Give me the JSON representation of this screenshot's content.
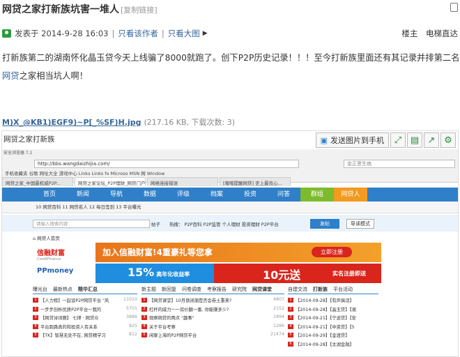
{
  "post": {
    "title": "网贷之家打新族坑害一堆人",
    "copy_link": "[复制链接]",
    "meta": {
      "posted": "发表于 2014-9-28 16:03",
      "sep": "|",
      "only_author": "只看该作者",
      "only_big_image": "只看大图",
      "floor_label": "楼主",
      "elevator": "电梯直达"
    },
    "body_line1": "打新族第二的湖南怀化晶玉贷今天上线骗了8000就跑了。创下P2P历史记录！！！至今打新族里面还有其记录并排第二名",
    "body_line2_link": "网贷",
    "body_line2_rest": "之家相当坑人啊！",
    "attachment": {
      "filename": "M)X_@KB1)EGF9)~P[_%SF)H.jpg",
      "info": "(217.16 KB, 下载次数: 3)"
    }
  },
  "image": {
    "watermark_title": "网贷之家打新族",
    "send_to_phone": "发送图片到手机",
    "window_label": "安全浏览器 7.1",
    "address": "http://bbs.wangdaizhijia.com/",
    "search_hint": "金正恩生病",
    "favorites": "手机收藏夹  谷歌  网址大全  游戏中心  Links  Links fo  Microso  MSN 网  Window",
    "tabs": [
      "网贷之家_中国最权威P2P...",
      "网贷之家论坛_P2P理财_网贷门户",
      "网络连接错误",
      "[喀喀提醒网贷] 史上最良心..."
    ],
    "nav": [
      "首页",
      "新闻",
      "导航",
      "数据",
      "评级",
      "档案",
      "投资",
      "问答",
      "群组",
      "网贷人"
    ],
    "subnav": "10 网贷百科    11 网贷名人    12 每日签到    13 平台曝光",
    "search_placeholder": "请输入搜索内容",
    "search_select": "帖子",
    "hot": "热搜：  P2P百科  P2P监管  个人理财  投资理财  P2P平台",
    "post_btn": "发帖",
    "guide_btn": "导读模式",
    "crumb": "网贷人首页",
    "banner1": {
      "logo": "信融财富",
      "logo_sub": "CreditFinance",
      "text": "加入信融财富!4重豪礼等您拿",
      "cta": "立即注册"
    },
    "banner2": {
      "logo": "PPmoney",
      "pct": "15%",
      "pct_sub": "高年化收益率",
      "amount": "10元送",
      "reg": "实名注册即送"
    },
    "col1_tabs": [
      "曝光台",
      "最新热点",
      "精华汇总"
    ],
    "col2_tabs": [
      "新主题",
      "新回复",
      "问卷调查",
      "考察报告",
      "研究院",
      "网贷课堂"
    ],
    "col3_tabs": [
      "自建交流",
      "打新族",
      "平台活动"
    ],
    "col1_rows": [
      {
        "n": "1",
        "t": "【人力榜】一起谈P2P网贷平台 \"风",
        "v": "11010"
      },
      {
        "n": "2",
        "t": "一步步剖析优质P2P平台一我的",
        "v": "5701"
      },
      {
        "n": "3",
        "t": "【网贷诗词赛】 七律 · 网贷众",
        "v": "3886"
      },
      {
        "n": "4",
        "t": "平台跑路真的和投资人有关系",
        "v": "825"
      },
      {
        "n": "5",
        "t": "【TK】智慧无处不在, 网贷精学习",
        "v": "812"
      }
    ],
    "col2_rows": [
      {
        "n": "1",
        "t": "【网贷课堂】10月倒闭潮是否会卷土重来?",
        "v": "4807"
      },
      {
        "n": "2",
        "t": "杠杆的威力一一房价翻一番, 你能赚多少?",
        "v": "2152"
      },
      {
        "n": "3",
        "t": "观察网贷的两点 \"趣事\"",
        "v": "1894"
      },
      {
        "n": "4",
        "t": "关于平台考察",
        "v": "1286"
      },
      {
        "n": "5",
        "t": "闲聊上海的P2P网贷平台",
        "v": "21474"
      }
    ],
    "col3_rows": [
      {
        "n": "1",
        "t": "【2014-09-28】【有声搞话】",
        "v": ""
      },
      {
        "n": "2",
        "t": "【2014-09-28】【晶玉贷】【湘",
        "v": ""
      },
      {
        "n": "3",
        "t": "【2014-09-21】【宁波贷】【安",
        "v": ""
      },
      {
        "n": "4",
        "t": "【2014-09-21】【中资贷】【5",
        "v": ""
      },
      {
        "n": "5",
        "t": "【2014-09-29】【金渡贷】",
        "v": ""
      },
      {
        "n": "6",
        "t": "【2014-09-28】【太湖金融】",
        "v": ""
      }
    ]
  }
}
